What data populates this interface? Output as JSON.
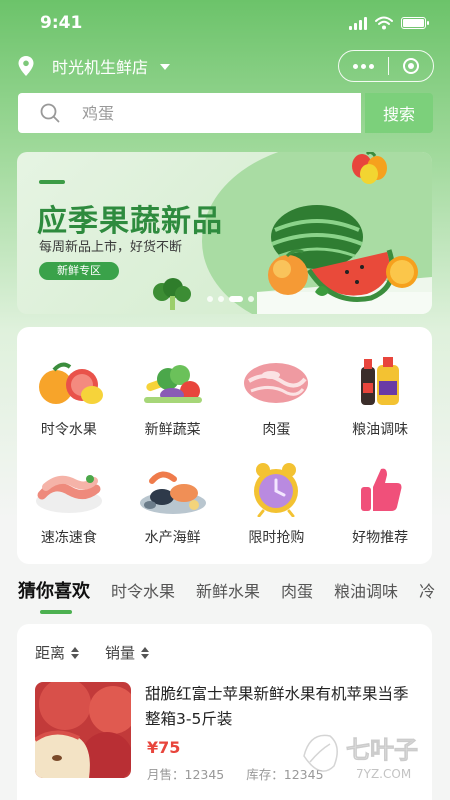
{
  "status_bar": {
    "time": "9:41"
  },
  "location": {
    "store_name": "时光机生鲜店"
  },
  "search": {
    "placeholder": "鸡蛋",
    "button_label": "搜索"
  },
  "banner": {
    "headline": "应季果蔬新品",
    "subline": "每周新品上市，好货不断",
    "tag": "新鲜专区",
    "pages": 4,
    "active_page": 3
  },
  "categories": [
    {
      "label": "时令水果",
      "icon": "citrus-fruits-icon"
    },
    {
      "label": "新鲜蔬菜",
      "icon": "vegetables-icon"
    },
    {
      "label": "肉蛋",
      "icon": "meat-icon"
    },
    {
      "label": "粮油调味",
      "icon": "oil-bottles-icon"
    },
    {
      "label": "速冻速食",
      "icon": "frozen-food-icon"
    },
    {
      "label": "水产海鲜",
      "icon": "seafood-icon"
    },
    {
      "label": "限时抢购",
      "icon": "alarm-clock-icon"
    },
    {
      "label": "好物推荐",
      "icon": "thumbs-up-icon"
    }
  ],
  "tabs": [
    {
      "label": "猜你喜欢",
      "active": true
    },
    {
      "label": "时令水果",
      "active": false
    },
    {
      "label": "新鲜水果",
      "active": false
    },
    {
      "label": "肉蛋",
      "active": false
    },
    {
      "label": "粮油调味",
      "active": false
    },
    {
      "label": "冷",
      "active": false
    }
  ],
  "sorts": [
    {
      "label": "距离"
    },
    {
      "label": "销量"
    }
  ],
  "product": {
    "name": "甜脆红富士苹果新鲜水果有机苹果当季整箱3-5斤装",
    "price": "¥75",
    "monthly_sales": "月售：12345",
    "stock": "库存：12345"
  },
  "watermark": {
    "brand": "七叶子",
    "domain": "7YZ.COM"
  },
  "colors": {
    "primary_green": "#4cb050",
    "price_red": "#e8453c",
    "search_button": "#7cd07b"
  }
}
